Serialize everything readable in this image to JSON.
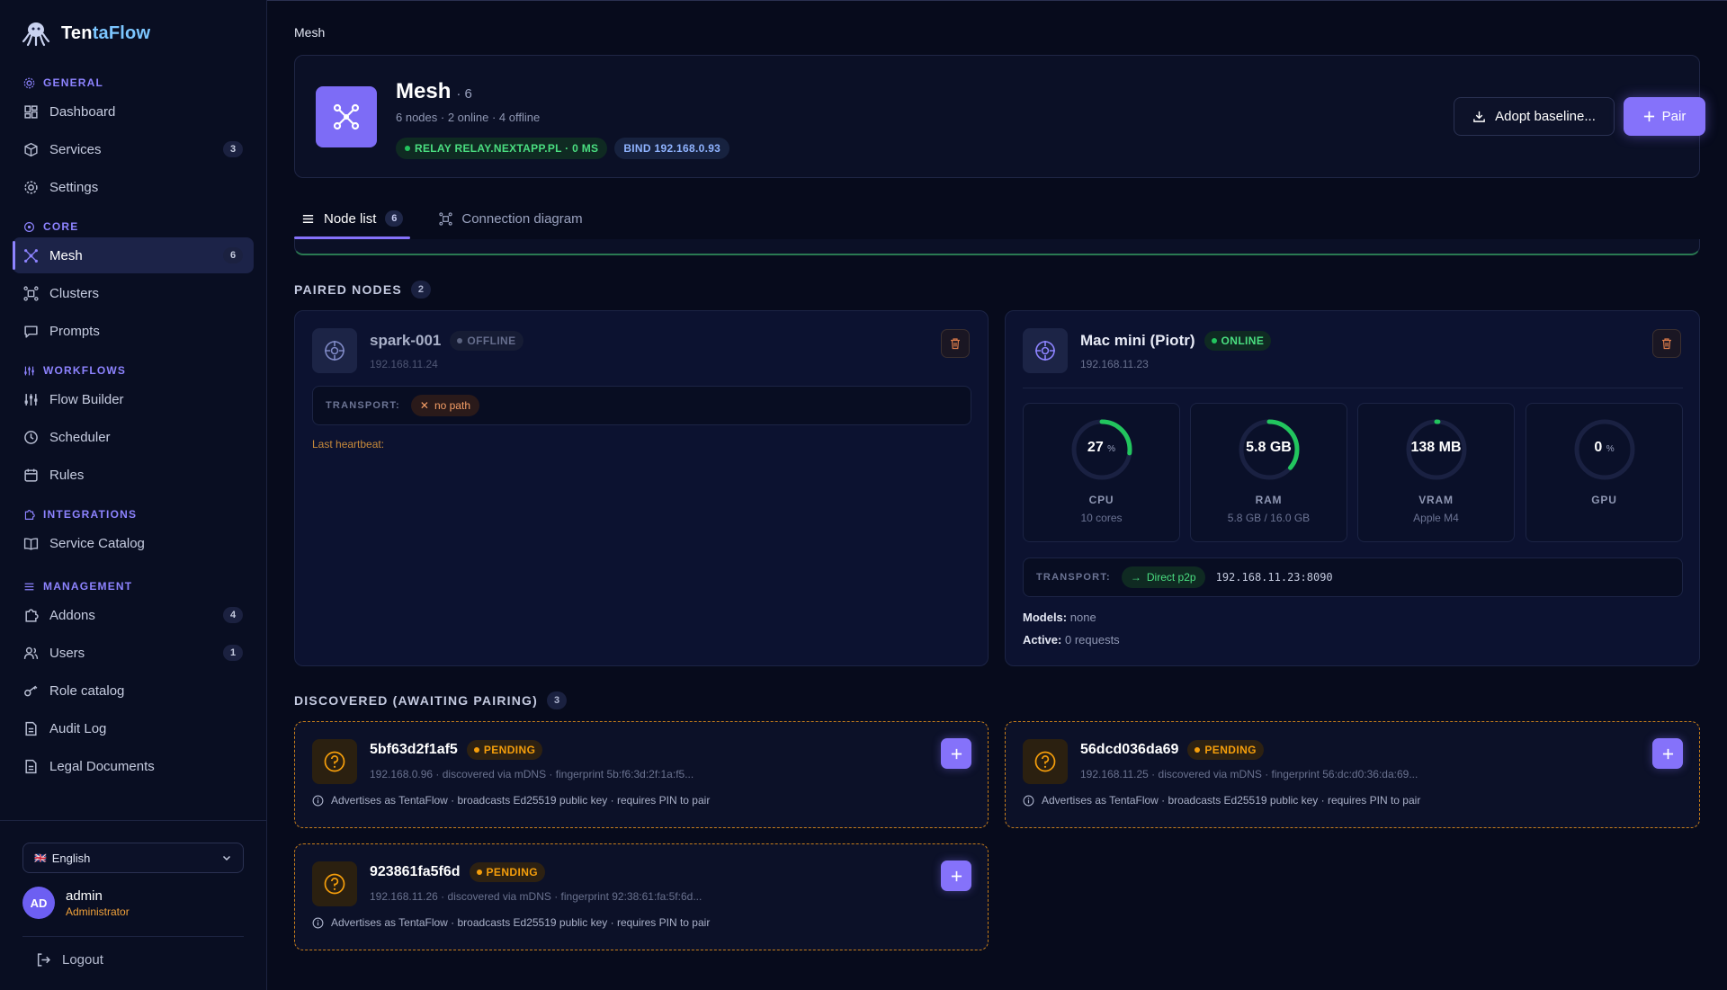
{
  "app": {
    "name_part1": "Ten",
    "name_part2": "taFlow"
  },
  "sidebar": {
    "sections": [
      {
        "title": "GENERAL",
        "items": [
          {
            "label": "Dashboard",
            "badge": ""
          },
          {
            "label": "Services",
            "badge": "3"
          },
          {
            "label": "Settings",
            "badge": ""
          }
        ]
      },
      {
        "title": "CORE",
        "items": [
          {
            "label": "Mesh",
            "badge": "6"
          },
          {
            "label": "Clusters",
            "badge": ""
          },
          {
            "label": "Prompts",
            "badge": ""
          }
        ]
      },
      {
        "title": "WORKFLOWS",
        "items": [
          {
            "label": "Flow Builder",
            "badge": ""
          },
          {
            "label": "Scheduler",
            "badge": ""
          },
          {
            "label": "Rules",
            "badge": ""
          }
        ]
      },
      {
        "title": "INTEGRATIONS",
        "items": [
          {
            "label": "Service Catalog",
            "badge": ""
          }
        ]
      },
      {
        "title": "MANAGEMENT",
        "items": [
          {
            "label": "Addons",
            "badge": "4"
          },
          {
            "label": "Users",
            "badge": "1"
          },
          {
            "label": "Role catalog",
            "badge": ""
          },
          {
            "label": "Audit Log",
            "badge": ""
          },
          {
            "label": "Legal Documents",
            "badge": ""
          }
        ]
      }
    ],
    "language": {
      "flag": "🇬🇧",
      "value": "English"
    },
    "user": {
      "initials": "AD",
      "name": "admin",
      "role": "Administrator"
    },
    "logout_label": "Logout"
  },
  "breadcrumb": "Mesh",
  "header": {
    "title": "Mesh",
    "count": "· 6",
    "subtitle": "6 nodes · 2 online · 4 offline",
    "relay_chip": "RELAY RELAY.NEXTAPP.PL · 0 MS",
    "bind_chip": "BIND 192.168.0.93",
    "adopt_button": "Adopt baseline...",
    "pair_button": "Pair"
  },
  "tabs": [
    {
      "label": "Node list",
      "badge": "6"
    },
    {
      "label": "Connection diagram",
      "badge": ""
    }
  ],
  "paired": {
    "title": "PAIRED NODES",
    "count": "2",
    "nodes": [
      {
        "name": "spark-001",
        "status": "OFFLINE",
        "ip": "192.168.11.24",
        "transport_label": "TRANSPORT:",
        "transport_value": "no path",
        "heartbeat": "Last heartbeat:"
      },
      {
        "name": "Mac mini (Piotr)",
        "status": "ONLINE",
        "ip": "192.168.11.23",
        "metrics": [
          {
            "value": "27",
            "unit": "%",
            "label": "CPU",
            "sub": "10 cores",
            "fraction": 0.27
          },
          {
            "value": "5.8 GB",
            "unit": "",
            "label": "RAM",
            "sub": "5.8 GB / 16.0 GB",
            "fraction": 0.3625
          },
          {
            "value": "138 MB",
            "unit": "",
            "label": "VRAM",
            "sub": "Apple M4",
            "fraction": 0.01
          },
          {
            "value": "0",
            "unit": "%",
            "label": "GPU",
            "sub": "",
            "fraction": 0
          }
        ],
        "transport_label": "TRANSPORT:",
        "transport_value": "Direct p2p",
        "transport_addr": "192.168.11.23:8090",
        "models_label": "Models:",
        "models_value": "none",
        "active_label": "Active:",
        "active_value": "0 requests"
      }
    ]
  },
  "discovered": {
    "title": "DISCOVERED (AWAITING PAIRING)",
    "count": "3",
    "nodes": [
      {
        "name": "5bf63d2f1af5",
        "status": "PENDING",
        "meta": "192.168.0.96 · discovered via mDNS · fingerprint 5b:f6:3d:2f:1a:f5...",
        "note": "Advertises as TentaFlow · broadcasts Ed25519 public key · requires PIN to pair"
      },
      {
        "name": "56dcd036da69",
        "status": "PENDING",
        "meta": "192.168.11.25 · discovered via mDNS · fingerprint 56:dc:d0:36:da:69...",
        "note": "Advertises as TentaFlow · broadcasts Ed25519 public key · requires PIN to pair"
      },
      {
        "name": "923861fa5f6d",
        "status": "PENDING",
        "meta": "192.168.11.26 · discovered via mDNS · fingerprint 92:38:61:fa:5f:6d...",
        "note": "Advertises as TentaFlow · broadcasts Ed25519 public key · requires PIN to pair"
      }
    ]
  },
  "colors": {
    "accent": "#8572fa",
    "online": "#22c55e",
    "pending": "#f59e0b"
  }
}
